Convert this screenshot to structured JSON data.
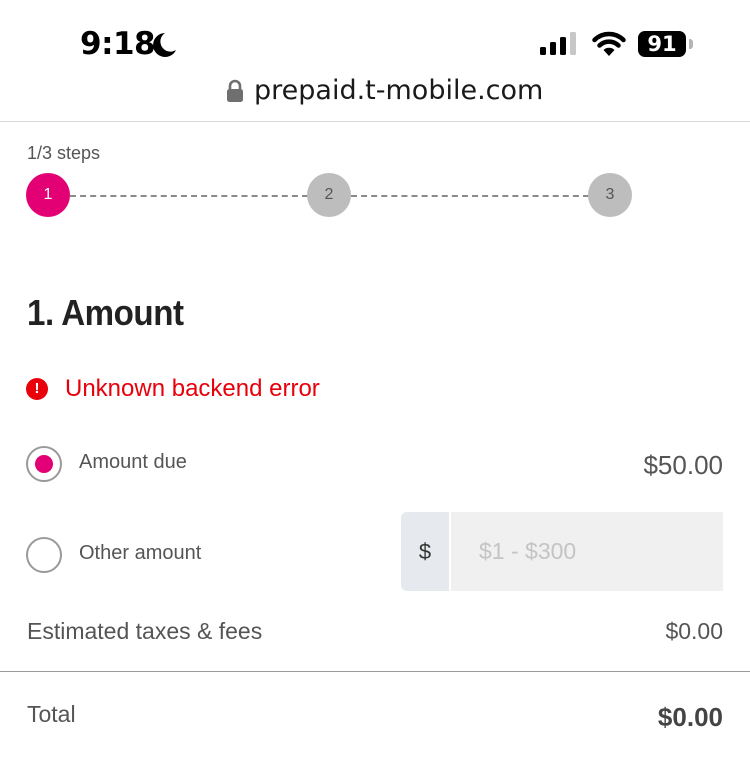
{
  "status_bar": {
    "time": "9:18",
    "battery": "91",
    "icons": [
      "moon-icon",
      "cellular-signal-icon",
      "wifi-icon",
      "battery-icon"
    ]
  },
  "browser": {
    "url": "prepaid.t-mobile.com",
    "lock_icon": "lock-icon"
  },
  "steps": {
    "label": "1/3 steps",
    "items": [
      "1",
      "2",
      "3"
    ],
    "current": 1
  },
  "form": {
    "title": "1. Amount",
    "error": {
      "icon": "exclamation-circle-icon",
      "text": "Unknown backend error"
    },
    "options": [
      {
        "label": "Amount due",
        "value": "$50.00",
        "selected": true
      },
      {
        "label": "Other amount",
        "selected": false
      }
    ],
    "other_amount": {
      "prefix": "$",
      "placeholder": "$1 - $300",
      "value": ""
    },
    "taxes": {
      "label": "Estimated taxes & fees",
      "value": "$0.00"
    },
    "total": {
      "label": "Total",
      "value": "$0.00"
    }
  },
  "colors": {
    "brand_magenta": "#e20074",
    "error_red": "#e8000b",
    "inactive_step": "#bdbdbd"
  }
}
